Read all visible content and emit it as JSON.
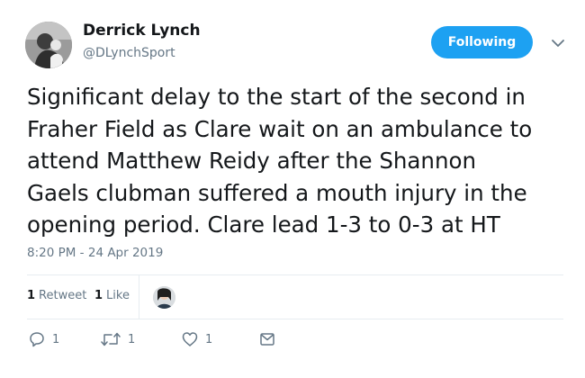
{
  "author": {
    "name": "Derrick Lynch",
    "handle": "@DLynchSport"
  },
  "follow_button": {
    "label": "Following",
    "color": "#1da1f2"
  },
  "tweet": {
    "text": "Significant delay to the start of the second in\nFraher Field as Clare wait on an ambulance to\nattend Matthew Reidy after the Shannon\nGaels clubman suffered a mouth injury in the\nopening period. Clare lead 1-3 to 0-3 at HT",
    "timestamp": "8:20 PM - 24 Apr 2019"
  },
  "stats": {
    "retweet_count": "1",
    "retweet_label": "Retweet",
    "like_count": "1",
    "like_label": "Like"
  },
  "actions": {
    "reply_count": "1",
    "retweet_count": "1",
    "like_count": "1"
  },
  "icons": {
    "reply": "reply-icon",
    "retweet": "retweet-icon",
    "like": "heart-icon",
    "dm": "envelope-icon",
    "caret": "chevron-down-icon"
  },
  "colors": {
    "text": "#14171a",
    "secondary": "#657786",
    "divider": "#e6ecf0"
  }
}
